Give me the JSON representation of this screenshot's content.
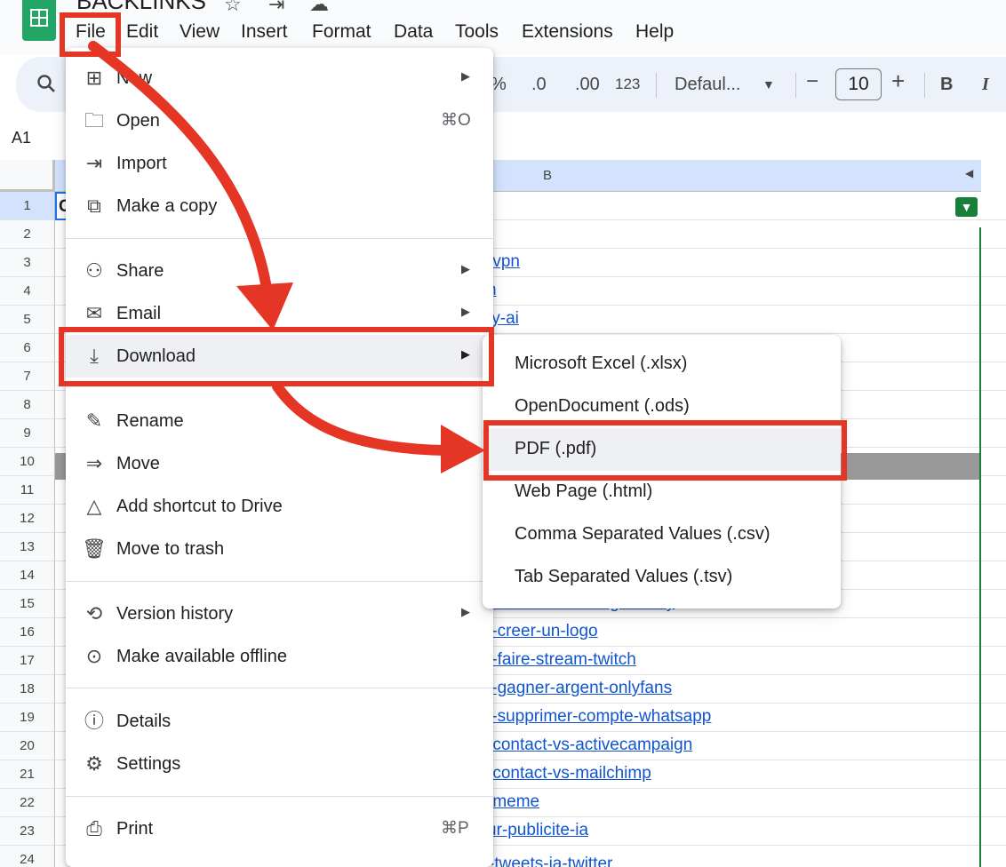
{
  "app": {
    "title": "BACKLINKS",
    "title_icons": [
      "star-icon",
      "move-to-folder-icon",
      "cloud-saved-icon"
    ]
  },
  "menubar": {
    "items": [
      "File",
      "Edit",
      "View",
      "Insert",
      "Format",
      "Data",
      "Tools",
      "Extensions",
      "Help"
    ]
  },
  "toolbar": {
    "percent": "%",
    "decrease_decimal": ".0",
    "increase_decimal": ".00",
    "number_format": "123",
    "font": "Defaul...",
    "font_size": "10",
    "minus": "−",
    "plus": "+",
    "bold": "B",
    "italic": "I"
  },
  "formula_bar": {
    "name_box": "A1"
  },
  "grid": {
    "column_b": "B",
    "a1_text": "C",
    "row_numbers": [
      "1",
      "2",
      "3",
      "4",
      "5",
      "6",
      "7",
      "8",
      "9",
      "10",
      "11",
      "12",
      "13",
      "14",
      "15",
      "16",
      "17",
      "18",
      "19",
      "20",
      "21",
      "22",
      "23",
      "24"
    ],
    "links": [
      {
        "row": 2,
        "text": "/"
      },
      {
        "row": 3,
        "text": "-vpn"
      },
      {
        "row": 4,
        "text": "n"
      },
      {
        "row": 5,
        "text": "ty-ai"
      },
      {
        "row": 15,
        "text": "t-creer-site-web-godaddy"
      },
      {
        "row": 16,
        "text": "t-creer-un-logo"
      },
      {
        "row": 17,
        "text": "t-faire-stream-twitch"
      },
      {
        "row": 18,
        "text": "t-gagner-argent-onlyfans"
      },
      {
        "row": 19,
        "text": "t-supprimer-compte-whatsapp"
      },
      {
        "row": 20,
        "text": "-contact-vs-activecampaign"
      },
      {
        "row": 21,
        "text": "-contact-vs-mailchimp"
      },
      {
        "row": 22,
        "text": "-meme"
      },
      {
        "row": 23,
        "text": "ur-publicite-ia"
      }
    ],
    "row24_url": "https://www.sales-hacking.com/fr/post/generateur-tweets-ia-twitter"
  },
  "file_menu": {
    "items": [
      {
        "label": "New",
        "icon": "new-sheet-icon",
        "has_submenu": true
      },
      {
        "label": "Open",
        "icon": "folder-icon",
        "shortcut": "⌘O"
      },
      {
        "label": "Import",
        "icon": "import-icon"
      },
      {
        "label": "Make a copy",
        "icon": "copy-icon"
      },
      {
        "label": "Share",
        "icon": "share-person-icon",
        "has_submenu": true
      },
      {
        "label": "Email",
        "icon": "email-icon",
        "has_submenu": true
      },
      {
        "label": "Download",
        "icon": "download-icon",
        "has_submenu": true
      },
      {
        "label": "Rename",
        "icon": "rename-icon"
      },
      {
        "label": "Move",
        "icon": "move-folder-icon"
      },
      {
        "label": "Add shortcut to Drive",
        "icon": "drive-shortcut-icon"
      },
      {
        "label": "Move to trash",
        "icon": "trash-icon"
      },
      {
        "label": "Version history",
        "icon": "history-icon",
        "has_submenu": true
      },
      {
        "label": "Make available offline",
        "icon": "offline-icon"
      },
      {
        "label": "Details",
        "icon": "info-icon"
      },
      {
        "label": "Settings",
        "icon": "settings-icon"
      },
      {
        "label": "Print",
        "icon": "print-icon",
        "shortcut": "⌘P"
      }
    ]
  },
  "download_submenu": {
    "items": [
      "Microsoft Excel (.xlsx)",
      "OpenDocument (.ods)",
      "PDF (.pdf)",
      "Web Page (.html)",
      "Comma Separated Values (.csv)",
      "Tab Separated Values (.tsv)"
    ]
  },
  "colors": {
    "highlight": "#e53525",
    "sheets_green": "#23a566",
    "link_blue": "#1155cc",
    "menu_hover": "#eef0f3"
  }
}
